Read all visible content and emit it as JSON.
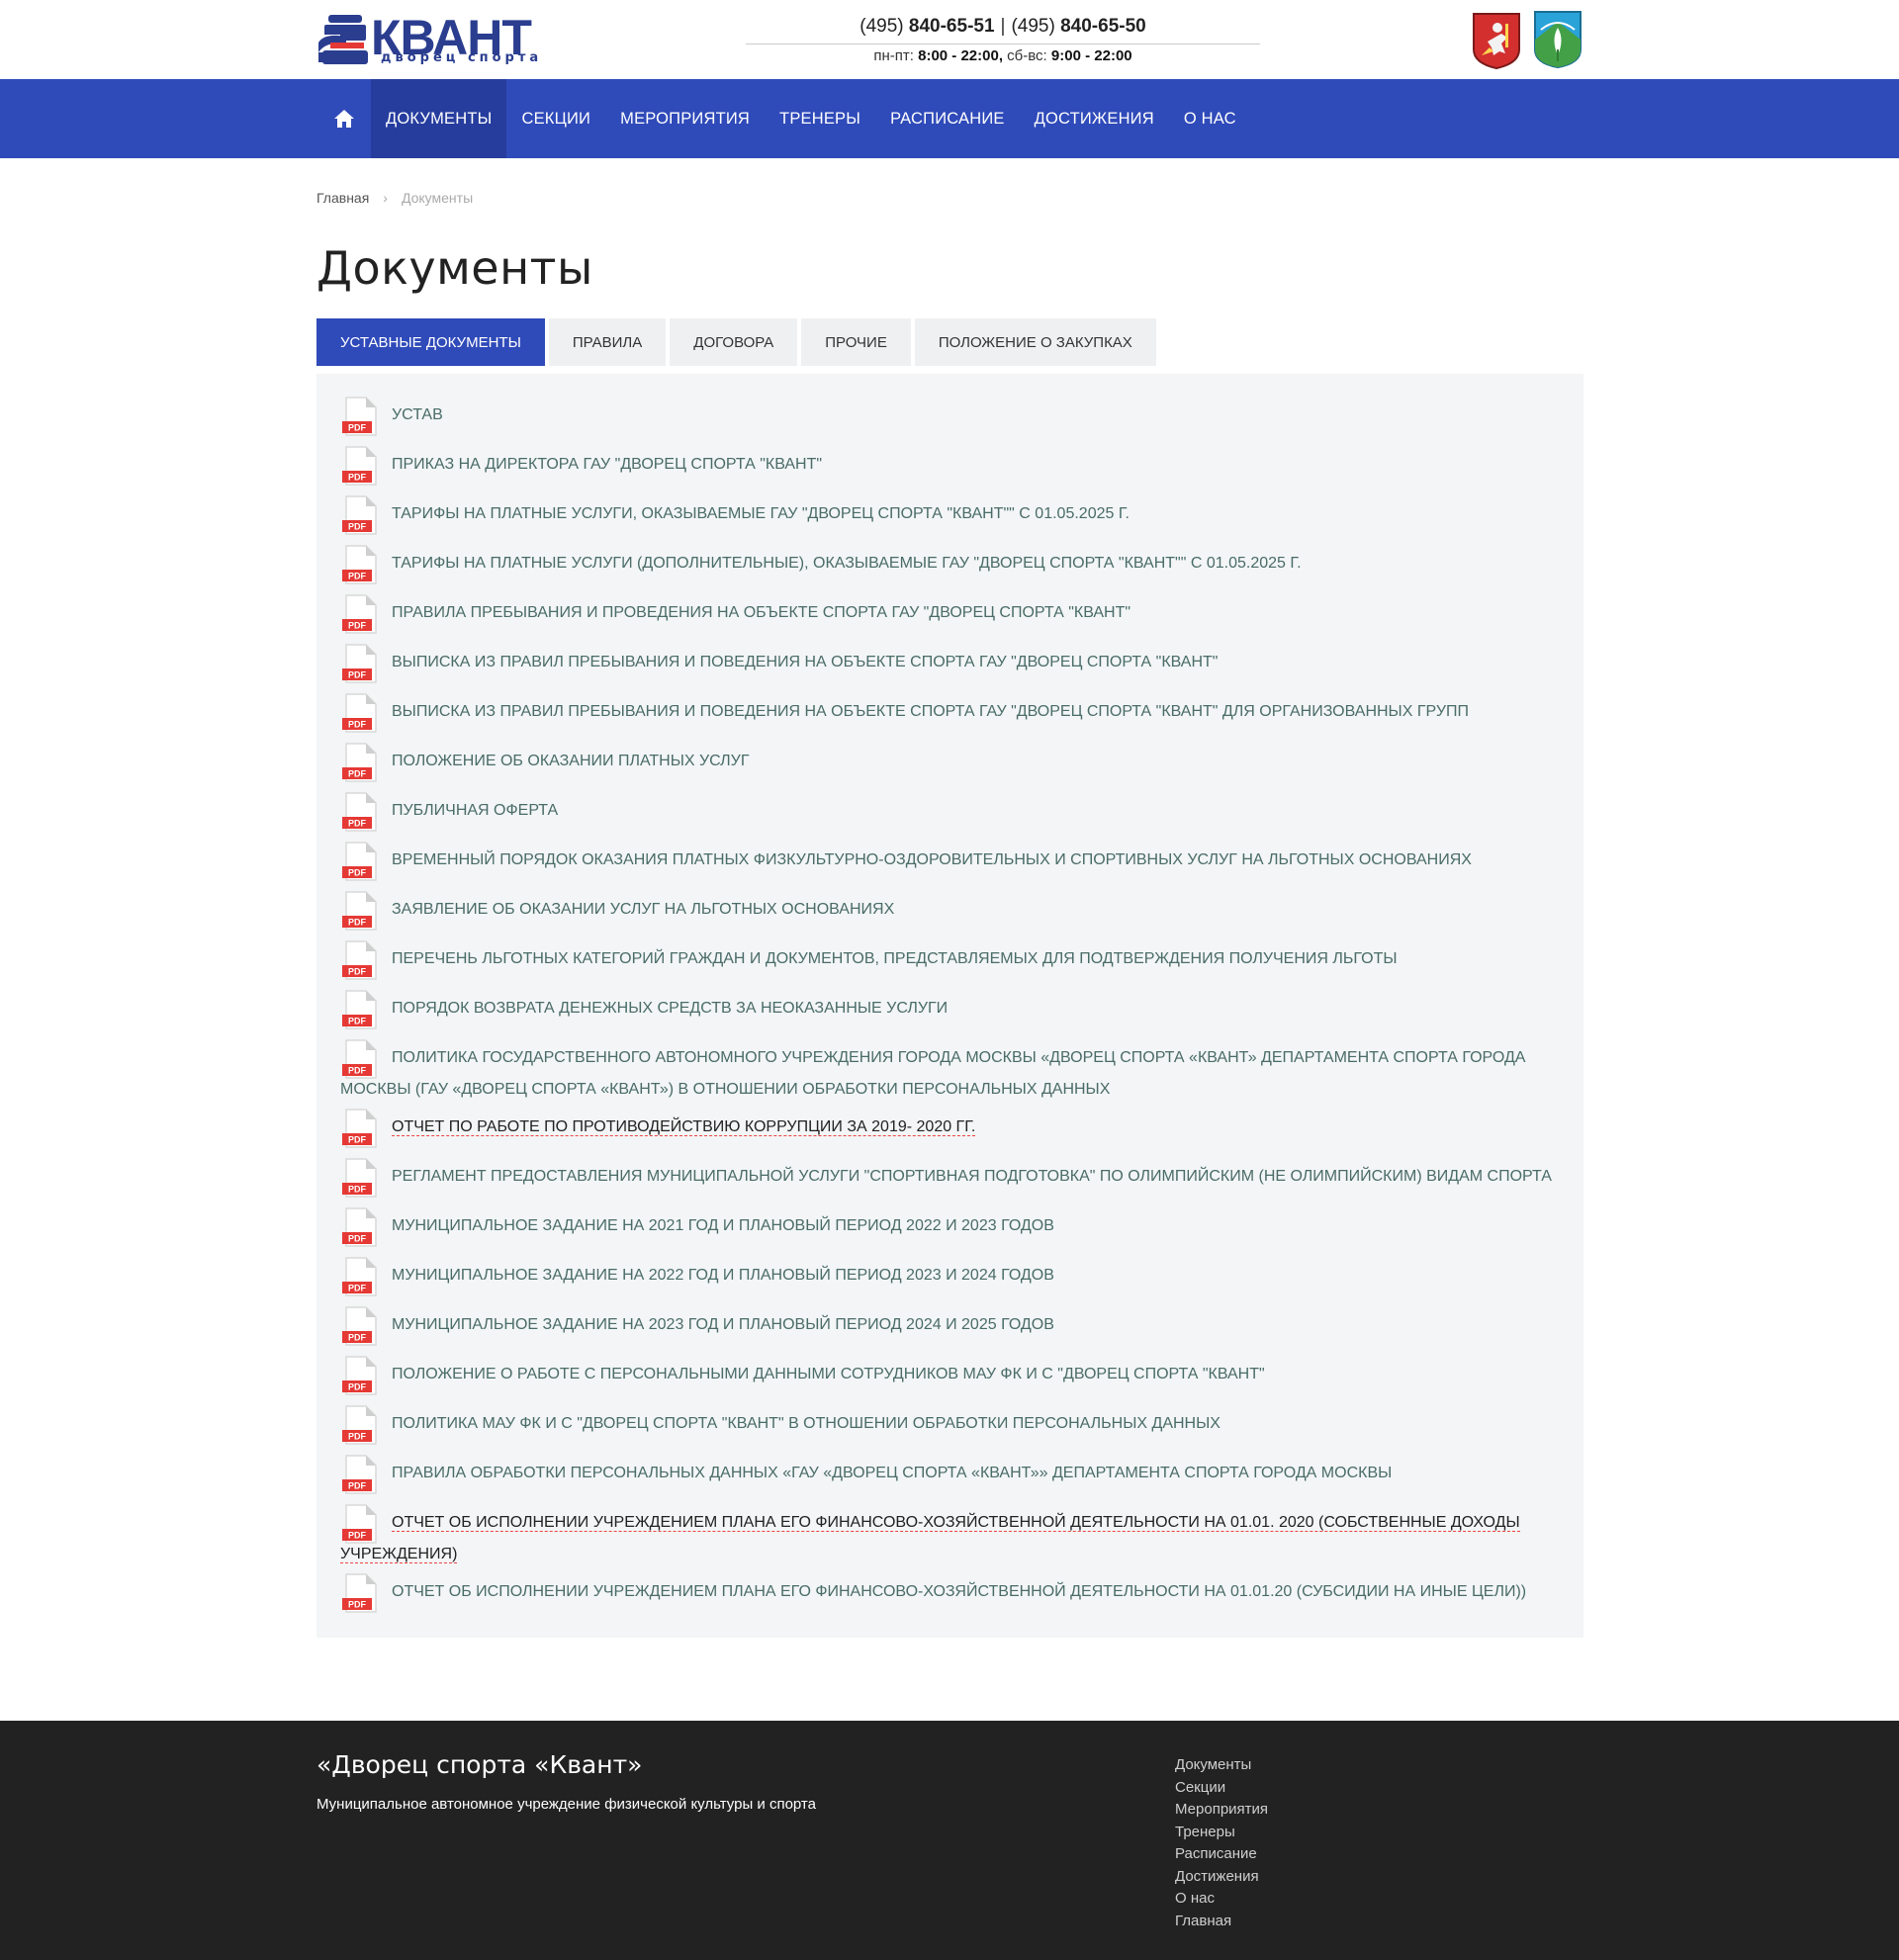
{
  "brand": {
    "name": "КВАНТ",
    "subtitle": "дворец спорта",
    "color": "#2a3d8f"
  },
  "contacts": {
    "phone1_code": "(495)",
    "phone1_num": "840-65-51",
    "separator": "|",
    "phone2_code": "(495)",
    "phone2_num": "840-65-50",
    "hours_weekday_label": "пн-пт:",
    "hours_weekday": "8:00 - 22:00,",
    "hours_weekend_label": "сб-вс:",
    "hours_weekend": "9:00 - 22:00"
  },
  "nav": {
    "home_icon": "home-icon",
    "items": [
      {
        "label": "ДОКУМЕНТЫ",
        "active": true
      },
      {
        "label": "СЕКЦИИ"
      },
      {
        "label": "МЕРОПРИЯТИЯ"
      },
      {
        "label": "ТРЕНЕРЫ"
      },
      {
        "label": "РАСПИСАНИЕ"
      },
      {
        "label": "ДОСТИЖЕНИЯ"
      },
      {
        "label": "О НАС"
      }
    ]
  },
  "breadcrumb": {
    "home": "Главная",
    "chevron": "›",
    "current": "Документы"
  },
  "page": {
    "title": "Документы"
  },
  "tabs": [
    {
      "label": "УСТАВНЫЕ ДОКУМЕНТЫ",
      "active": true
    },
    {
      "label": "ПРАВИЛА"
    },
    {
      "label": "ДОГОВОРА"
    },
    {
      "label": "ПРОЧИЕ"
    },
    {
      "label": "ПОЛОЖЕНИЕ О ЗАКУПКАХ"
    }
  ],
  "docs": {
    "pdf_badge": "PDF",
    "items": [
      {
        "label": "УСТАВ"
      },
      {
        "label": "ПРИКАЗ НА ДИРЕКТОРА ГАУ \"ДВОРЕЦ СПОРТА \"КВАНТ\""
      },
      {
        "label": "ТАРИФЫ НА ПЛАТНЫЕ УСЛУГИ, ОКАЗЫВАЕМЫЕ ГАУ \"ДВОРЕЦ СПОРТА \"КВАНТ\"\" С 01.05.2025 Г."
      },
      {
        "label": "ТАРИФЫ НА ПЛАТНЫЕ УСЛУГИ (ДОПОЛНИТЕЛЬНЫЕ), ОКАЗЫВАЕМЫЕ ГАУ \"ДВОРЕЦ СПОРТА \"КВАНТ\"\" С 01.05.2025 Г."
      },
      {
        "label": "ПРАВИЛА ПРЕБЫВАНИЯ И ПРОВЕДЕНИЯ НА ОБЪЕКТЕ СПОРТА ГАУ \"ДВОРЕЦ СПОРТА \"КВАНТ\""
      },
      {
        "label": "ВЫПИСКА ИЗ ПРАВИЛ ПРЕБЫВАНИЯ И ПОВЕДЕНИЯ НА ОБЪЕКТЕ СПОРТА ГАУ \"ДВОРЕЦ СПОРТА \"КВАНТ\""
      },
      {
        "label": "ВЫПИСКА ИЗ ПРАВИЛ ПРЕБЫВАНИЯ И ПОВЕДЕНИЯ НА ОБЪЕКТЕ СПОРТА ГАУ \"ДВОРЕЦ СПОРТА \"КВАНТ\" ДЛЯ ОРГАНИЗОВАННЫХ ГРУПП"
      },
      {
        "label": "ПОЛОЖЕНИЕ ОБ ОКАЗАНИИ ПЛАТНЫХ УСЛУГ"
      },
      {
        "label": "ПУБЛИЧНАЯ ОФЕРТА"
      },
      {
        "label": "ВРЕМЕННЫЙ ПОРЯДОК ОКАЗАНИЯ ПЛАТНЫХ ФИЗКУЛЬТУРНО-ОЗДОРОВИТЕЛЬНЫХ И СПОРТИВНЫХ УСЛУГ НА ЛЬГОТНЫХ ОСНОВАНИЯХ"
      },
      {
        "label": "ЗАЯВЛЕНИЕ ОБ ОКАЗАНИИ УСЛУГ НА ЛЬГОТНЫХ ОСНОВАНИЯХ"
      },
      {
        "label": "ПЕРЕЧЕНЬ ЛЬГОТНЫХ КАТЕГОРИЙ ГРАЖДАН И ДОКУМЕНТОВ, ПРЕДСТАВЛЯЕМЫХ ДЛЯ ПОДТВЕРЖДЕНИЯ ПОЛУЧЕНИЯ ЛЬГОТЫ"
      },
      {
        "label": "ПОРЯДОК ВОЗВРАТА ДЕНЕЖНЫХ СРЕДСТВ ЗА НЕОКАЗАННЫЕ УСЛУГИ"
      },
      {
        "label": "ПОЛИТИКА ГОСУДАРСТВЕННОГО АВТОНОМНОГО УЧРЕЖДЕНИЯ ГОРОДА МОСКВЫ «ДВОРЕЦ СПОРТА «КВАНТ» ДЕПАРТАМЕНТА СПОРТА ГОРОДА МОСКВЫ (ГАУ «ДВОРЕЦ СПОРТА «КВАНТ») В ОТНОШЕНИИ ОБРАБОТКИ ПЕРСОНАЛЬНЫХ ДАННЫХ",
        "multi": true
      },
      {
        "label": "ОТЧЕТ ПО РАБОТЕ ПО ПРОТИВОДЕЙСТВИЮ КОРРУПЦИИ ЗА 2019- 2020 ГГ.",
        "link": true
      },
      {
        "label": "РЕГЛАМЕНТ ПРЕДОСТАВЛЕНИЯ МУНИЦИПАЛЬНОЙ УСЛУГИ \"СПОРТИВНАЯ ПОДГОТОВКА\" ПО ОЛИМПИЙСКИМ (НЕ ОЛИМПИЙСКИМ) ВИДАМ СПОРТА",
        "multi": true
      },
      {
        "label": "МУНИЦИПАЛЬНОЕ ЗАДАНИЕ НА 2021 ГОД И ПЛАНОВЫЙ ПЕРИОД 2022 И 2023 ГОДОВ"
      },
      {
        "label": "МУНИЦИПАЛЬНОЕ ЗАДАНИЕ НА 2022 ГОД И ПЛАНОВЫЙ ПЕРИОД 2023 И 2024 ГОДОВ"
      },
      {
        "label": "МУНИЦИПАЛЬНОЕ ЗАДАНИЕ НА 2023 ГОД И ПЛАНОВЫЙ ПЕРИОД 2024 И 2025 ГОДОВ"
      },
      {
        "label": "ПОЛОЖЕНИЕ О РАБОТЕ С ПЕРСОНАЛЬНЫМИ ДАННЫМИ СОТРУДНИКОВ МАУ ФК И С \"ДВОРЕЦ СПОРТА \"КВАНТ\""
      },
      {
        "label": "ПОЛИТИКА МАУ ФК И С \"ДВОРЕЦ СПОРТА \"КВАНТ\" В ОТНОШЕНИИ ОБРАБОТКИ ПЕРСОНАЛЬНЫХ ДАННЫХ"
      },
      {
        "label": "ПРАВИЛА ОБРАБОТКИ ПЕРСОНАЛЬНЫХ ДАННЫХ «ГАУ «ДВОРЕЦ СПОРТА «КВАНТ»» ДЕПАРТАМЕНТА СПОРТА ГОРОДА МОСКВЫ"
      },
      {
        "label": "ОТЧЕТ ОБ ИСПОЛНЕНИИ УЧРЕЖДЕНИЕМ ПЛАНА ЕГО ФИНАНСОВО-ХОЗЯЙСТВЕННОЙ ДЕЯТЕЛЬНОСТИ НА 01.01. 2020 (СОБСТВЕННЫЕ ДОХОДЫ УЧРЕЖДЕНИЯ)",
        "multi": true,
        "link": true
      },
      {
        "label": "ОТЧЕТ ОБ ИСПОЛНЕНИИ УЧРЕЖДЕНИЕМ ПЛАНА ЕГО ФИНАНСОВО-ХОЗЯЙСТВЕННОЙ ДЕЯТЕЛЬНОСТИ НА 01.01.20 (СУБСИДИИ НА ИНЫЕ ЦЕЛИ))",
        "multi": true
      }
    ]
  },
  "footer": {
    "title": "«Дворец спорта «Квант»",
    "subtitle": "Муниципальное автономное учреждение физической культуры и спорта",
    "menu": [
      "Документы",
      "Секции",
      "Мероприятия",
      "Тренеры",
      "Расписание",
      "Достижения",
      "О нас",
      "Главная"
    ]
  },
  "colors": {
    "nav": "#2f4ab9",
    "nav_active": "#263d9e",
    "panel": "#f3f5f6",
    "doc_text": "#4a6c68",
    "footer": "#222222",
    "pdf_red": "#e53935"
  }
}
